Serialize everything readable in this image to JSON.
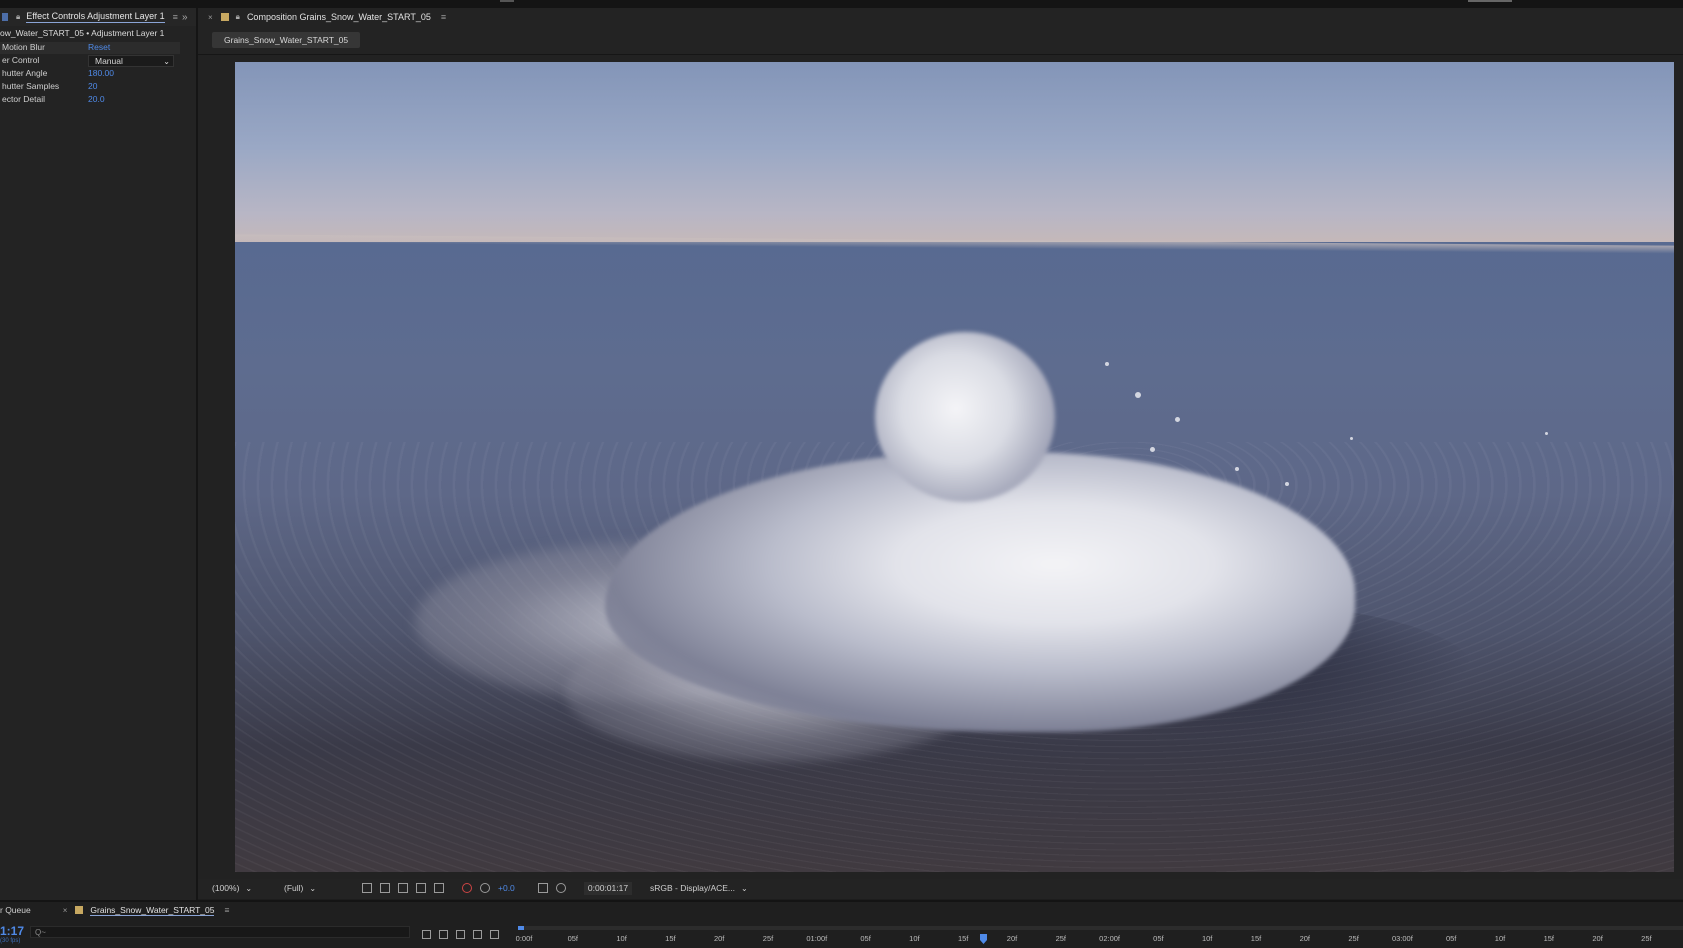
{
  "effect_controls": {
    "panel_title": "Effect Controls Adjustment Layer 1",
    "layer_path": "ow_Water_START_05 • Adjustment Layer 1",
    "effect_name": "Motion Blur",
    "reset_label": "Reset",
    "props": [
      {
        "name": "er Control",
        "value": "Manual"
      },
      {
        "name": "hutter Angle",
        "value": "180.00"
      },
      {
        "name": "hutter Samples",
        "value": "20"
      },
      {
        "name": "ector Detail",
        "value": "20.0"
      }
    ]
  },
  "composition": {
    "panel_title": "Composition Grains_Snow_Water_START_05",
    "tab_label": "Grains_Snow_Water_START_05"
  },
  "viewer_controls": {
    "zoom": "(100%)",
    "resolution": "(Full)",
    "exposure": "+0.0",
    "timecode": "0:00:01:17",
    "color_management": "sRGB - Display/ACE..."
  },
  "timeline": {
    "render_queue_label": "r Queue",
    "comp_tab": "Grains_Snow_Water_START_05",
    "current_time": "1:17",
    "fps": "(30 fps)",
    "search_placeholder": "Q~",
    "ticks": [
      "0:00f",
      "05f",
      "10f",
      "15f",
      "20f",
      "25f",
      "01:00f",
      "05f",
      "10f",
      "15f",
      "20f",
      "25f",
      "02:00f",
      "05f",
      "10f",
      "15f",
      "20f",
      "25f",
      "03:00f",
      "05f",
      "10f",
      "15f",
      "20f",
      "25f"
    ]
  },
  "colors": {
    "accent_blue": "#4f8ae8",
    "panel_bg": "#232323",
    "comp_swatch": "#c7a861"
  }
}
